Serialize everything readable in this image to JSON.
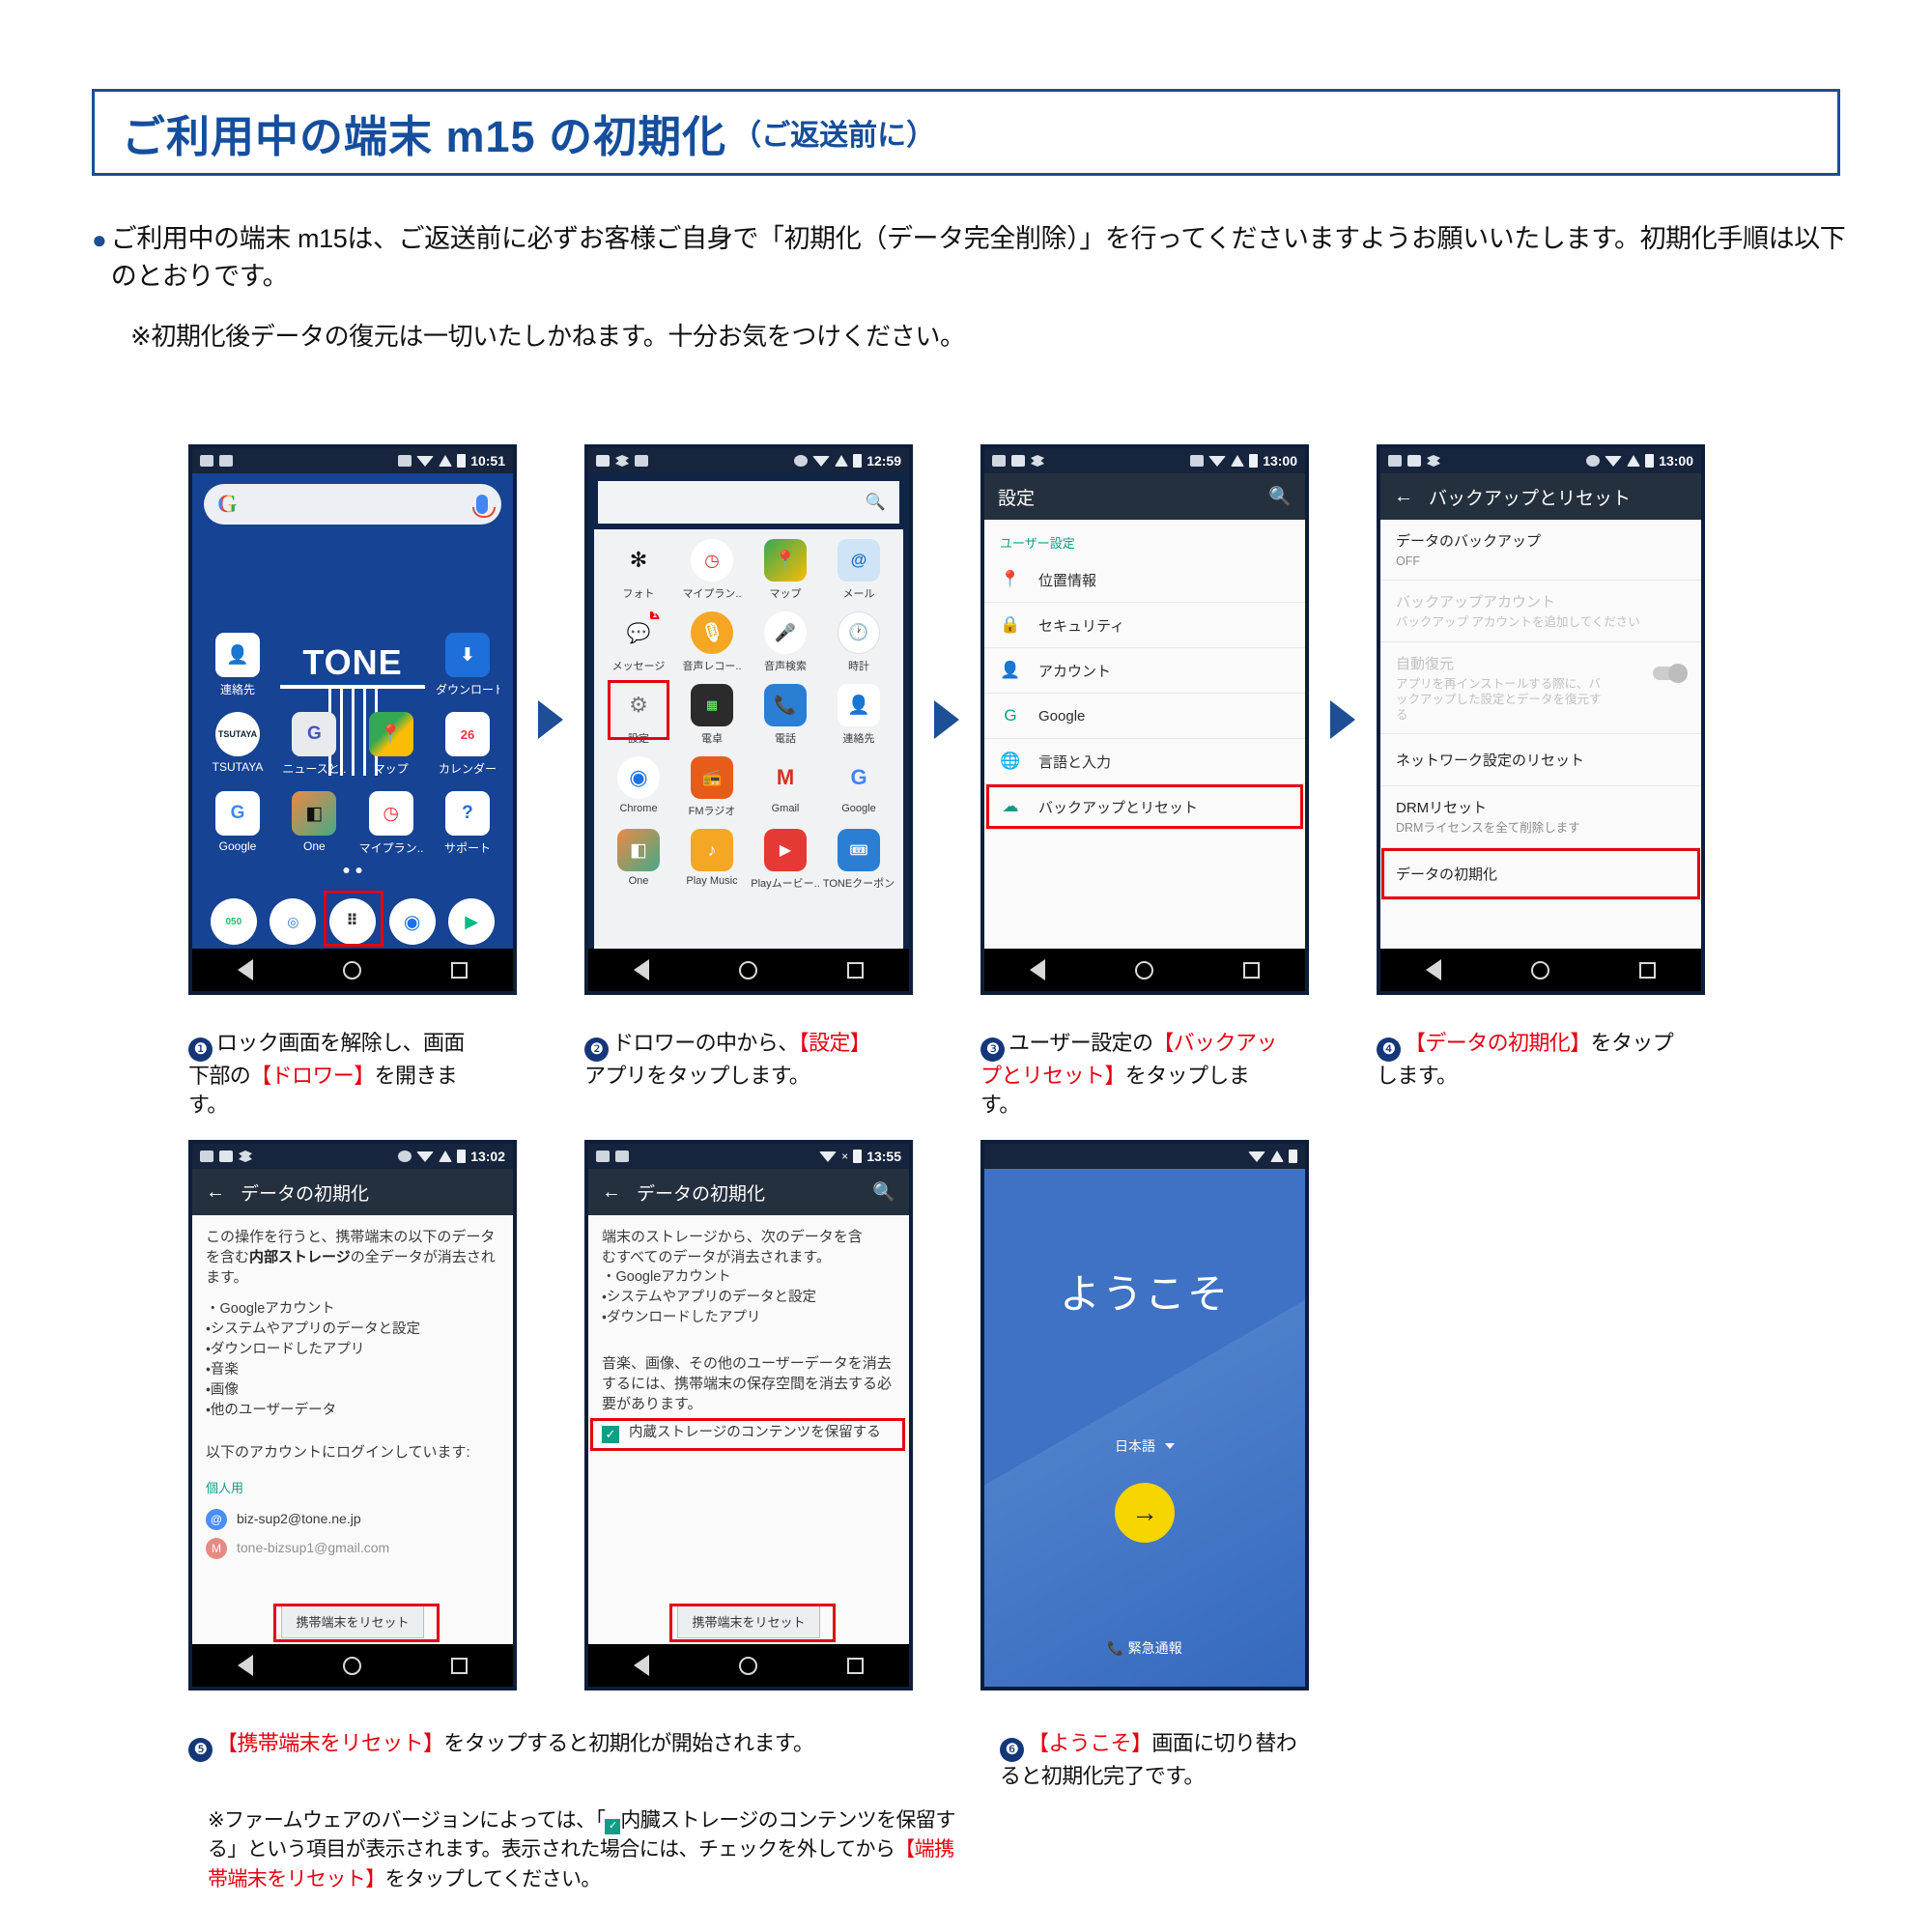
{
  "header": {
    "title": "ご利用中の端末 m15 の初期化",
    "subtitle": "（ご返送前に）"
  },
  "intro": {
    "bullet_text": "ご利用中の端末 m15は、ご返送前に必ずお客様ご自身で「初期化（データ完全削除）」を行ってくださいますようお願いいたします。初期化手順は以下のとおりです。",
    "note": "※初期化後データの復元は一切いたしかねます。十分お気をつけください。"
  },
  "phone1": {
    "status_time": "10:51",
    "search_placeholder": "",
    "tone_logo": "TONE",
    "apps_row1": [
      {
        "label": "連絡先"
      },
      {
        "label": "ダウンロード"
      }
    ],
    "apps_row2": [
      {
        "label": "TSUTAYA"
      },
      {
        "label": "ニュースと.."
      },
      {
        "label": "マップ"
      },
      {
        "label": "カレンダー"
      }
    ],
    "apps_row3": [
      {
        "label": "Google"
      },
      {
        "label": "One"
      },
      {
        "label": "マイプラン.."
      },
      {
        "label": "サポート"
      }
    ],
    "dock": [
      {
        "label": "050"
      },
      {
        "label": "app"
      },
      {
        "label": "drawer"
      },
      {
        "label": "Chrome"
      },
      {
        "label": "Play"
      }
    ]
  },
  "phone2": {
    "status_time": "12:59",
    "apps": [
      {
        "label": "フォト"
      },
      {
        "label": "マイプラン.."
      },
      {
        "label": "マップ"
      },
      {
        "label": "メール"
      },
      {
        "label": "メッセージ"
      },
      {
        "label": "音声レコー.."
      },
      {
        "label": "音声検索"
      },
      {
        "label": "時計"
      },
      {
        "label": "設定"
      },
      {
        "label": "電卓"
      },
      {
        "label": "電話"
      },
      {
        "label": "連絡先"
      },
      {
        "label": "Chrome"
      },
      {
        "label": "FMラジオ"
      },
      {
        "label": "Gmail"
      },
      {
        "label": "Google"
      },
      {
        "label": "One"
      },
      {
        "label": "Play Music"
      },
      {
        "label": "Playムービー.."
      },
      {
        "label": "TONEクーポン"
      }
    ],
    "message_badge": "1"
  },
  "phone3": {
    "status_time": "13:00",
    "appbar_title": "設定",
    "section_label": "ユーザー設定",
    "items": [
      {
        "label": "位置情報",
        "icon": "location-icon"
      },
      {
        "label": "セキュリティ",
        "icon": "lock-icon"
      },
      {
        "label": "アカウント",
        "icon": "account-icon"
      },
      {
        "label": "Google",
        "icon": "google-icon"
      },
      {
        "label": "言語と入力",
        "icon": "globe-icon"
      },
      {
        "label": "バックアップとリセット",
        "icon": "cloud-icon"
      }
    ],
    "highlight_index": 5
  },
  "phone4": {
    "status_time": "13:00",
    "appbar_title": "バックアップとリセット",
    "items": [
      {
        "title": "データのバックアップ",
        "sub": "OFF",
        "dim": false,
        "toggle": false
      },
      {
        "title": "バックアップアカウント",
        "sub": "バックアップ アカウントを追加してください",
        "dim": true,
        "toggle": false
      },
      {
        "title": "自動復元",
        "sub": "アプリを再インストールする際に、バックアップした設定とデータを復元する",
        "dim": true,
        "toggle": true
      },
      {
        "title": "ネットワーク設定のリセット",
        "sub": "",
        "dim": false,
        "toggle": false
      },
      {
        "title": "DRMリセット",
        "sub": "DRMライセンスを全て削除します",
        "dim": false,
        "toggle": false
      },
      {
        "title": "データの初期化",
        "sub": "",
        "dim": false,
        "toggle": false
      }
    ],
    "highlight_index": 5
  },
  "phone5": {
    "status_time": "13:02",
    "appbar_title": "データの初期化",
    "paragraph_1": "この操作を行うと、携帯端末の以下のデ",
    "paragraph_2": "ータを含む",
    "paragraph_bold": "内部ストレージ",
    "paragraph_3": "の全データが",
    "paragraph_4": "消去されます。",
    "bullets": [
      "・Googleアカウント",
      "・システムやアプリのデータと設定",
      "・ダウンロードしたアプリ",
      "・音楽",
      "・画像",
      "・他のユーザーデータ"
    ],
    "login_label": "以下のアカウントにログインしています:",
    "account_section": "個人用",
    "accounts": [
      "biz-sup2@tone.ne.jp",
      "tone-bizsup1@gmail.com"
    ],
    "reset_button": "携帯端末をリセット"
  },
  "phone6": {
    "status_time": "13:55",
    "appbar_title": "データの初期化",
    "paragraph_1": "端末のストレージから、次のデータを含",
    "paragraph_2": "むすべてのデータが消去されます。",
    "bullets": [
      "・Googleアカウント",
      "・システムやアプリのデータと設定",
      "・ダウンロードしたアプリ"
    ],
    "paragraph_3": "音楽、画像、その他のユーザーデータを消去するには、携帯端末の保存空間を消去する必要があります。",
    "checkbox_label": "内蔵ストレージのコンテンツを保留する",
    "checkbox_checked": true,
    "reset_button": "携帯端末をリセット"
  },
  "phone7": {
    "welcome_title": "ようこそ",
    "language": "日本語",
    "emergency": "緊急通報",
    "go_arrow": "→"
  },
  "captions": {
    "c1": {
      "num": "❶",
      "parts": [
        {
          "t": "ロック画面を解除し、画面下部の",
          "red": false
        },
        {
          "t": "【ドロワー】",
          "red": true
        },
        {
          "t": "を開きます。",
          "red": false
        }
      ]
    },
    "c2": {
      "num": "❷",
      "parts": [
        {
          "t": "ドロワーの中から、",
          "red": false
        },
        {
          "t": "【設定】",
          "red": true
        },
        {
          "t": "アプリをタップします。",
          "red": false
        }
      ]
    },
    "c3": {
      "num": "❸",
      "parts": [
        {
          "t": "ユーザー設定の",
          "red": false
        },
        {
          "t": "【バックアップとリセット】",
          "red": true
        },
        {
          "t": "をタップします。",
          "red": false
        }
      ]
    },
    "c4": {
      "num": "❹",
      "parts": [
        {
          "t": "",
          "red": false
        },
        {
          "t": "【データの初期化】",
          "red": true
        },
        {
          "t": "をタップします。",
          "red": false
        }
      ]
    },
    "c5": {
      "num": "❺",
      "parts": [
        {
          "t": "",
          "red": false
        },
        {
          "t": "【携帯端末をリセット】",
          "red": true
        },
        {
          "t": "をタップすると初期化が開始されます。",
          "red": false
        }
      ]
    },
    "c6": {
      "num": "❻",
      "parts": [
        {
          "t": "",
          "red": false
        },
        {
          "t": "【ようこそ】",
          "red": true
        },
        {
          "t": "画面に切り替わると初期化完了です。",
          "red": false
        }
      ]
    }
  },
  "footnote": {
    "line1_a": "※ファームウェアのバージョンによっては、「",
    "line1_b": "内臓ストレージのコンテンツを保留す",
    "line2": "る」という項目が表示されます。表示された場合には、チェックを外してから",
    "line2_red": "【端携",
    "line3_red": "帯端末をリセット】",
    "line3": "をタップしてください。"
  },
  "colors": {
    "brand_blue": "#15377a",
    "accent_red": "#e60012",
    "teal": "#0f9d86",
    "home_blue": "#164393"
  }
}
